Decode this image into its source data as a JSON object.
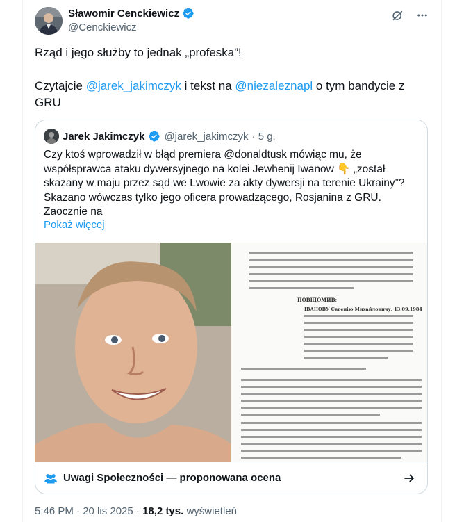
{
  "author": {
    "name": "Sławomir Cenckiewicz",
    "handle": "@Cenckiewicz"
  },
  "tweet": {
    "line1": "Rząd i jego służby to jednak „profeska”!",
    "line2_prefix": "Czytajcie ",
    "mention1": "@jarek_jakimczyk",
    "line2_mid": " i tekst na ",
    "mention2": "@niezaleznapl",
    "line2_suffix": " o tym bandycie z GRU"
  },
  "quote": {
    "name": "Jarek Jakimczyk",
    "handle": "@jarek_jakimczyk",
    "time": "· 5 g.",
    "text": "Czy ktoś wprowadził w błąd premiera @donaldtusk  mówiąc mu, że współsprawca ataku dywersyjnego na kolei Jewhenij Iwanow 👇 „został skazany w maju przez sąd we Lwowie za akty dywersji na terenie Ukrainy”? Skazano wówczas tylko jego oficera prowadzącego, Rosjanina z GRU. Zaocznie na",
    "show_more": "Pokaż więcej",
    "doc_heading": "ПОВІДОМИВ:",
    "doc_name": "ІВАНОВУ Євгенію Михайловичу, 13.09.1984",
    "community_label": "Uwagi Społeczności — proponowana ocena"
  },
  "meta": {
    "time": "5:46 PM · 20 lis 2025 · ",
    "views": "18,2 tys.",
    "views_label": " wyświetleń"
  },
  "colors": {
    "accent": "#1d9bf0",
    "text": "#0f1419",
    "muted": "#536471",
    "border": "#cfd9de"
  },
  "icons": [
    "verified-badge-icon",
    "grok-icon",
    "more-icon",
    "community-notes-icon",
    "arrow-right-icon"
  ]
}
